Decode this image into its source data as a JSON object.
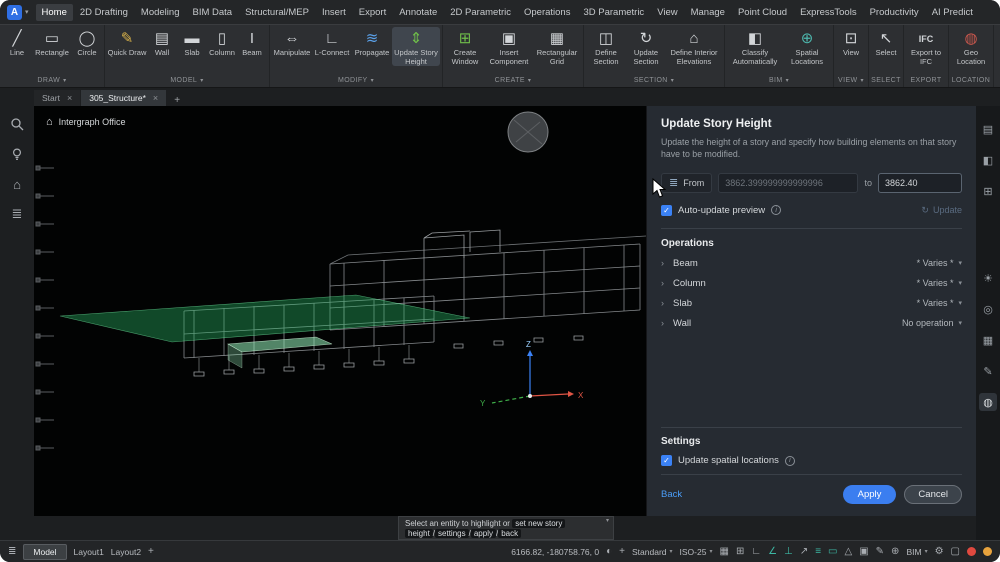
{
  "colors": {
    "accent_blue": "#3b7ef0",
    "link_blue": "#4a9df8",
    "selection_green": "#2ecc71",
    "status_active_teal": "#3cb8a4",
    "alert_red": "#e0493f",
    "alert_orange": "#e8a33d"
  },
  "ui_glyphs": {
    "caret": "▾",
    "chevron_right": "›",
    "close": "×",
    "add": "+",
    "check": "✓",
    "info": "i",
    "refresh": "↻",
    "home": "⌂",
    "story": "≣",
    "slash": "/"
  },
  "menubar": {
    "app_icon": "A",
    "items": [
      "Home",
      "2D Drafting",
      "Modeling",
      "BIM Data",
      "Structural/MEP",
      "Insert",
      "Export",
      "Annotate",
      "2D Parametric",
      "Operations",
      "3D Parametric",
      "View",
      "Manage",
      "Point Cloud",
      "ExpressTools",
      "Productivity",
      "AI Predict"
    ]
  },
  "ribbon": {
    "groups": [
      {
        "label": "DRAW",
        "tools": [
          {
            "label": "Line",
            "glyph": "╱"
          },
          {
            "label": "Rectangle",
            "glyph": "▭"
          },
          {
            "label": "Circle",
            "glyph": "◯"
          }
        ]
      },
      {
        "label": "MODEL",
        "tools": [
          {
            "label": "Quick Draw",
            "glyph": "✎"
          },
          {
            "label": "Wall",
            "glyph": "▤"
          },
          {
            "label": "Slab",
            "glyph": "▬"
          },
          {
            "label": "Column",
            "glyph": "▯"
          },
          {
            "label": "Beam",
            "glyph": "I"
          }
        ]
      },
      {
        "label": "MODIFY",
        "tools": [
          {
            "label": "Manipulate",
            "glyph": "⇔"
          },
          {
            "label": "L-Connect",
            "glyph": "∟"
          },
          {
            "label": "Propagate",
            "glyph": "≋"
          },
          {
            "label": "Update Story Height",
            "glyph": "⇕"
          }
        ]
      },
      {
        "label": "CREATE",
        "tools": [
          {
            "label": "Create Window",
            "glyph": "⊞"
          },
          {
            "label": "Insert Component",
            "glyph": "▣"
          },
          {
            "label": "Rectangular Grid",
            "glyph": "▦"
          }
        ]
      },
      {
        "label": "SECTION",
        "tools": [
          {
            "label": "Define Section",
            "glyph": "◫"
          },
          {
            "label": "Update Section",
            "glyph": "↻"
          },
          {
            "label": "Define Interior Elevations",
            "glyph": "⌂"
          }
        ]
      },
      {
        "label": "BIM",
        "tools": [
          {
            "label": "Classify Automatically",
            "glyph": "◧"
          },
          {
            "label": "Spatial Locations",
            "glyph": "⊕"
          }
        ]
      },
      {
        "label": "VIEW",
        "tools": [
          {
            "label": "View",
            "glyph": "⊡"
          }
        ]
      },
      {
        "label": "SELECT",
        "tools": [
          {
            "label": "Select",
            "glyph": "↖"
          }
        ]
      },
      {
        "label": "EXPORT",
        "tools": [
          {
            "label": "Export to IFC",
            "glyph": "IFC"
          }
        ]
      },
      {
        "label": "LOCATION",
        "tools": [
          {
            "label": "Geo Location",
            "glyph": "◍"
          }
        ]
      }
    ]
  },
  "doc_tabs": {
    "tabs": [
      {
        "label": "Start"
      },
      {
        "label": "305_Structure*"
      }
    ]
  },
  "left_strip": {
    "icons": [
      {
        "name": "search"
      },
      {
        "name": "bulb"
      },
      {
        "name": "home",
        "glyph": "⌂"
      },
      {
        "name": "structures",
        "glyph": "≣"
      }
    ]
  },
  "right_strip": {
    "icons": [
      {
        "glyph": "▤"
      },
      {
        "glyph": "◧"
      },
      {
        "glyph": "⊞"
      },
      {
        "glyph": "☀"
      },
      {
        "glyph": "◎"
      },
      {
        "glyph": "▦"
      },
      {
        "glyph": "✎"
      },
      {
        "glyph": "◍"
      }
    ]
  },
  "viewport": {
    "project_label": "Intergraph Office",
    "ucs_x": "X",
    "ucs_y": "Y",
    "ucs_z": "Z"
  },
  "panel": {
    "title": "Update Story Height",
    "description": "Update the height of a story and specify how building elements on that story have to be modified.",
    "from_label": "From",
    "from_value": "3862.399999999999996",
    "to_label": "to",
    "to_value": "3862.40",
    "auto_update_label": "Auto-update preview",
    "update_label": "Update",
    "operations_title": "Operations",
    "operations": [
      {
        "name": "Beam",
        "value": "* Varies *"
      },
      {
        "name": "Column",
        "value": "* Varies *"
      },
      {
        "name": "Slab",
        "value": "* Varies *"
      },
      {
        "name": "Wall",
        "value": "No operation"
      }
    ],
    "settings_title": "Settings",
    "spatial_label": "Update spatial locations",
    "back_label": "Back",
    "apply_label": "Apply",
    "cancel_label": "Cancel"
  },
  "cmd": {
    "line1_prefix": "Select an entity to highlight or",
    "line1_boxed": "set new story",
    "opt1": "height",
    "opt2": "settings",
    "opt3": "apply",
    "opt4": "back"
  },
  "statusbar": {
    "left_icon": "≣",
    "model": "Model",
    "layout1": "Layout1",
    "layout2": "Layout2",
    "coordinates": "6166.82, -180758.76, 0",
    "mid_icons": [
      {
        "name": "ucs-icon",
        "glyph": "◐"
      },
      {
        "name": "crosshair-icon",
        "glyph": "+"
      }
    ],
    "standard": "Standard",
    "dim_style": "ISO-25",
    "toggles": [
      {
        "name": "snap-icon",
        "glyph": "▦",
        "active": false
      },
      {
        "name": "grid-icon",
        "glyph": "⊞",
        "active": false
      },
      {
        "name": "ortho-icon",
        "glyph": "∟",
        "active": false
      },
      {
        "name": "polar-icon",
        "glyph": "∠",
        "active": true
      },
      {
        "name": "esnap-icon",
        "glyph": "⊥",
        "active": true
      },
      {
        "name": "tracking-icon",
        "glyph": "↗",
        "active": false
      },
      {
        "name": "lineweight-icon",
        "glyph": "≡",
        "active": true
      },
      {
        "name": "tablet-icon",
        "glyph": "▭",
        "active": true
      },
      {
        "name": "dynamic-input-icon",
        "glyph": "△",
        "active": false
      },
      {
        "name": "quad-icon",
        "glyph": "▣",
        "active": false
      },
      {
        "name": "annotation-icon",
        "glyph": "✎",
        "active": false
      },
      {
        "name": "ucs-toggle-icon",
        "glyph": "⊕",
        "active": false
      }
    ],
    "bim": "BIM",
    "right_icons": [
      {
        "name": "gear-icon",
        "glyph": "⚙"
      },
      {
        "name": "monitor-icon",
        "glyph": "▢"
      }
    ]
  }
}
